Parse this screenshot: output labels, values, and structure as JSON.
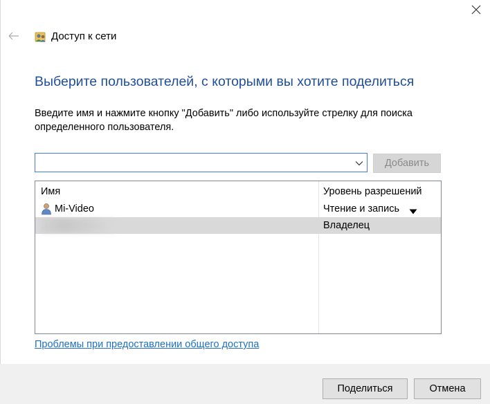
{
  "window": {
    "title": "Доступ к сети"
  },
  "icons": {
    "close": "close-icon",
    "back": "back-arrow-icon",
    "title": "network-users-icon",
    "combo_arrow": "chevron-down-icon",
    "user": "user-icon",
    "perm_arrow": "triangle-down-icon"
  },
  "heading": "Выберите пользователей, с которыми вы хотите поделиться",
  "instruction": "Введите имя и нажмите кнопку \"Добавить\" либо используйте стрелку для поиска определенного пользователя.",
  "user_input": {
    "value": "",
    "placeholder": ""
  },
  "add_button": "Добавить",
  "table": {
    "columns": [
      "Имя",
      "Уровень разрешений"
    ],
    "rows": [
      {
        "name": "Mi-Video",
        "permission": "Чтение и запись"
      },
      {
        "name": "",
        "permission": "Владелец"
      }
    ]
  },
  "help_link": "Проблемы при предоставлении общего доступа",
  "buttons": {
    "share": "Поделиться",
    "cancel": "Отмена"
  },
  "colors": {
    "heading": "#1f4e9c",
    "link": "#1f6fc4",
    "input_border": "#3d7edb",
    "selected_row": "#d9d9d9",
    "footer": "#f0f0f0"
  }
}
